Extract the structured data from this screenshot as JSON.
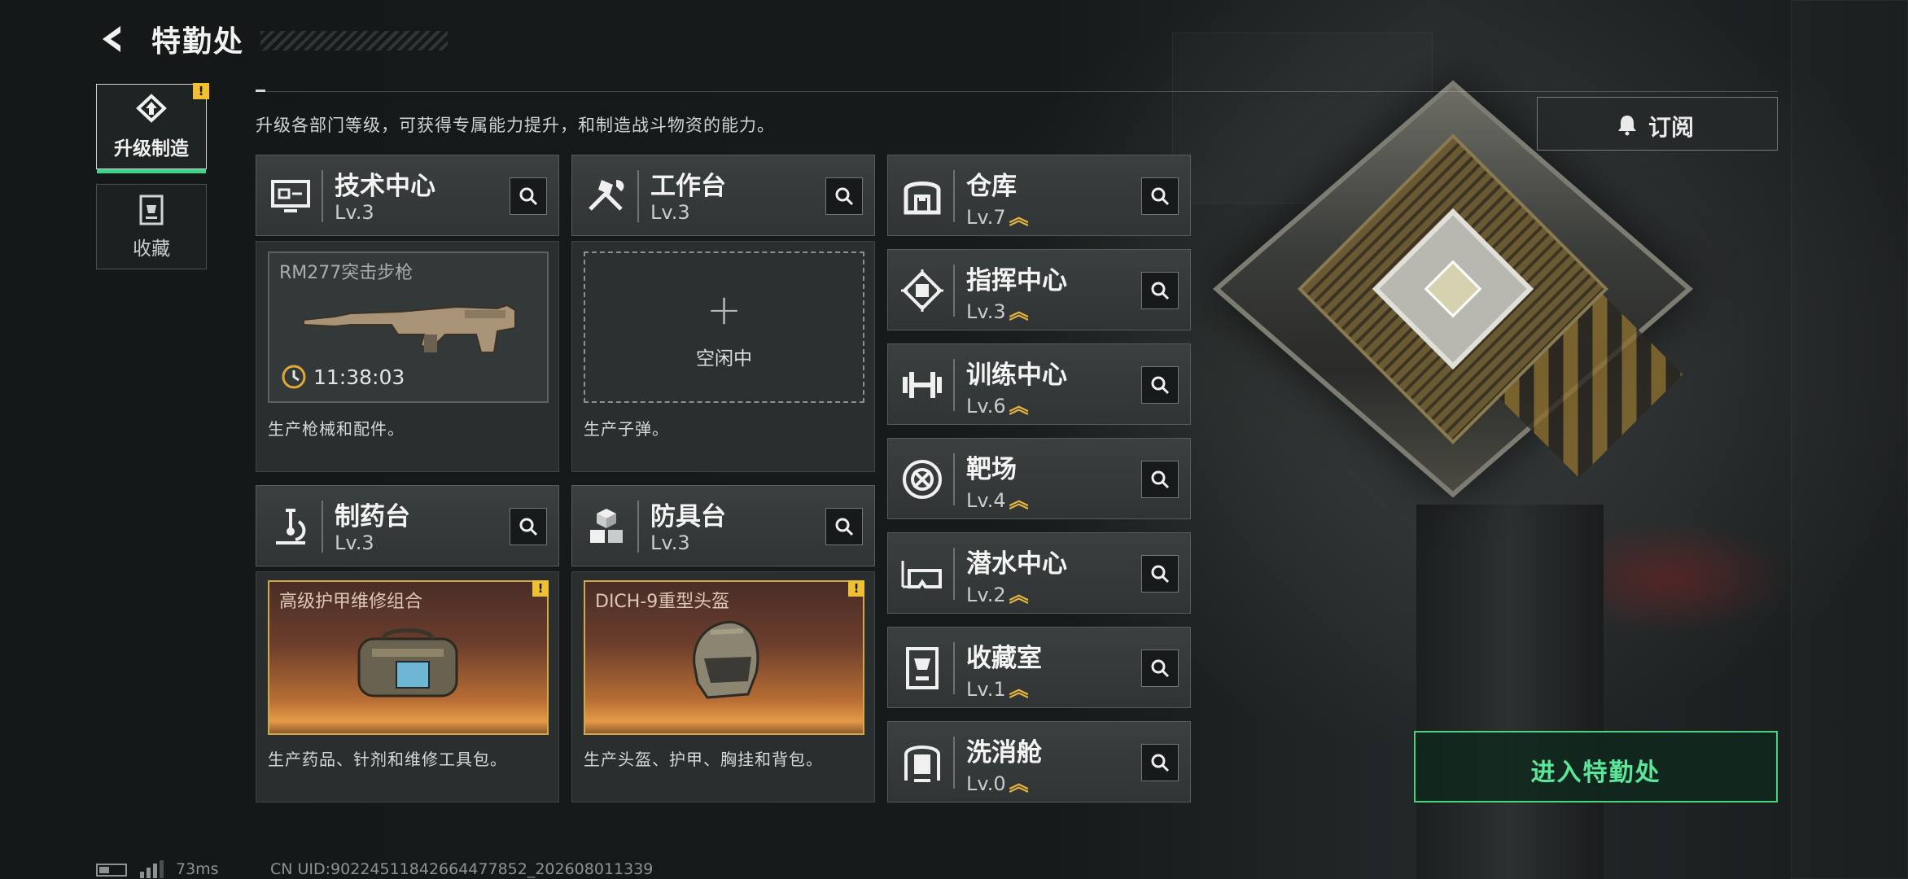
{
  "header": {
    "title": "特勤处"
  },
  "nav": {
    "items": [
      {
        "label": "升级制造",
        "active": true,
        "warn": "!"
      },
      {
        "label": "收藏",
        "active": false
      }
    ]
  },
  "description": "升级各部门等级，可获得专属能力提升，和制造战斗物资的能力。",
  "subscribe": {
    "label": "订阅"
  },
  "enter": {
    "label": "进入特勤处"
  },
  "production": [
    {
      "name": "技术中心",
      "level": "Lv.3",
      "icon": "monitor-icon",
      "item": "RM277突击步枪",
      "timer": "11:38:03",
      "footer": "生产枪械和配件。"
    },
    {
      "name": "工作台",
      "level": "Lv.3",
      "icon": "tools-icon",
      "idle": "空闲中",
      "footer": "生产子弹。"
    },
    {
      "name": "制药台",
      "level": "Lv.3",
      "icon": "microscope-icon",
      "item": "高级护甲维修组合",
      "warn": "!",
      "footer": "生产药品、针剂和维修工具包。"
    },
    {
      "name": "防具台",
      "level": "Lv.3",
      "icon": "cubes-icon",
      "item": "DICH-9重型头盔",
      "warn": "!",
      "footer": "生产头盔、护甲、胸挂和背包。"
    }
  ],
  "departments": [
    {
      "name": "仓库",
      "level": "Lv.7",
      "upgradable": true,
      "icon": "warehouse-icon"
    },
    {
      "name": "指挥中心",
      "level": "Lv.3",
      "upgradable": true,
      "icon": "chip-icon"
    },
    {
      "name": "训练中心",
      "level": "Lv.6",
      "upgradable": true,
      "icon": "dumbbell-icon"
    },
    {
      "name": "靶场",
      "level": "Lv.4",
      "upgradable": true,
      "icon": "target-icon"
    },
    {
      "name": "潜水中心",
      "level": "Lv.2",
      "upgradable": true,
      "icon": "diving-mask-icon"
    },
    {
      "name": "收藏室",
      "level": "Lv.1",
      "upgradable": true,
      "icon": "trophy-room-icon"
    },
    {
      "name": "洗消舱",
      "level": "Lv.0",
      "upgradable": true,
      "icon": "decon-icon"
    }
  ],
  "status": {
    "ping": "73ms",
    "uid": "CN UID:9022451184266447785​2_202608011339"
  },
  "colors": {
    "accent": "#3fd28a",
    "warn": "#f0c030",
    "upgrade": "#e4b43c"
  }
}
